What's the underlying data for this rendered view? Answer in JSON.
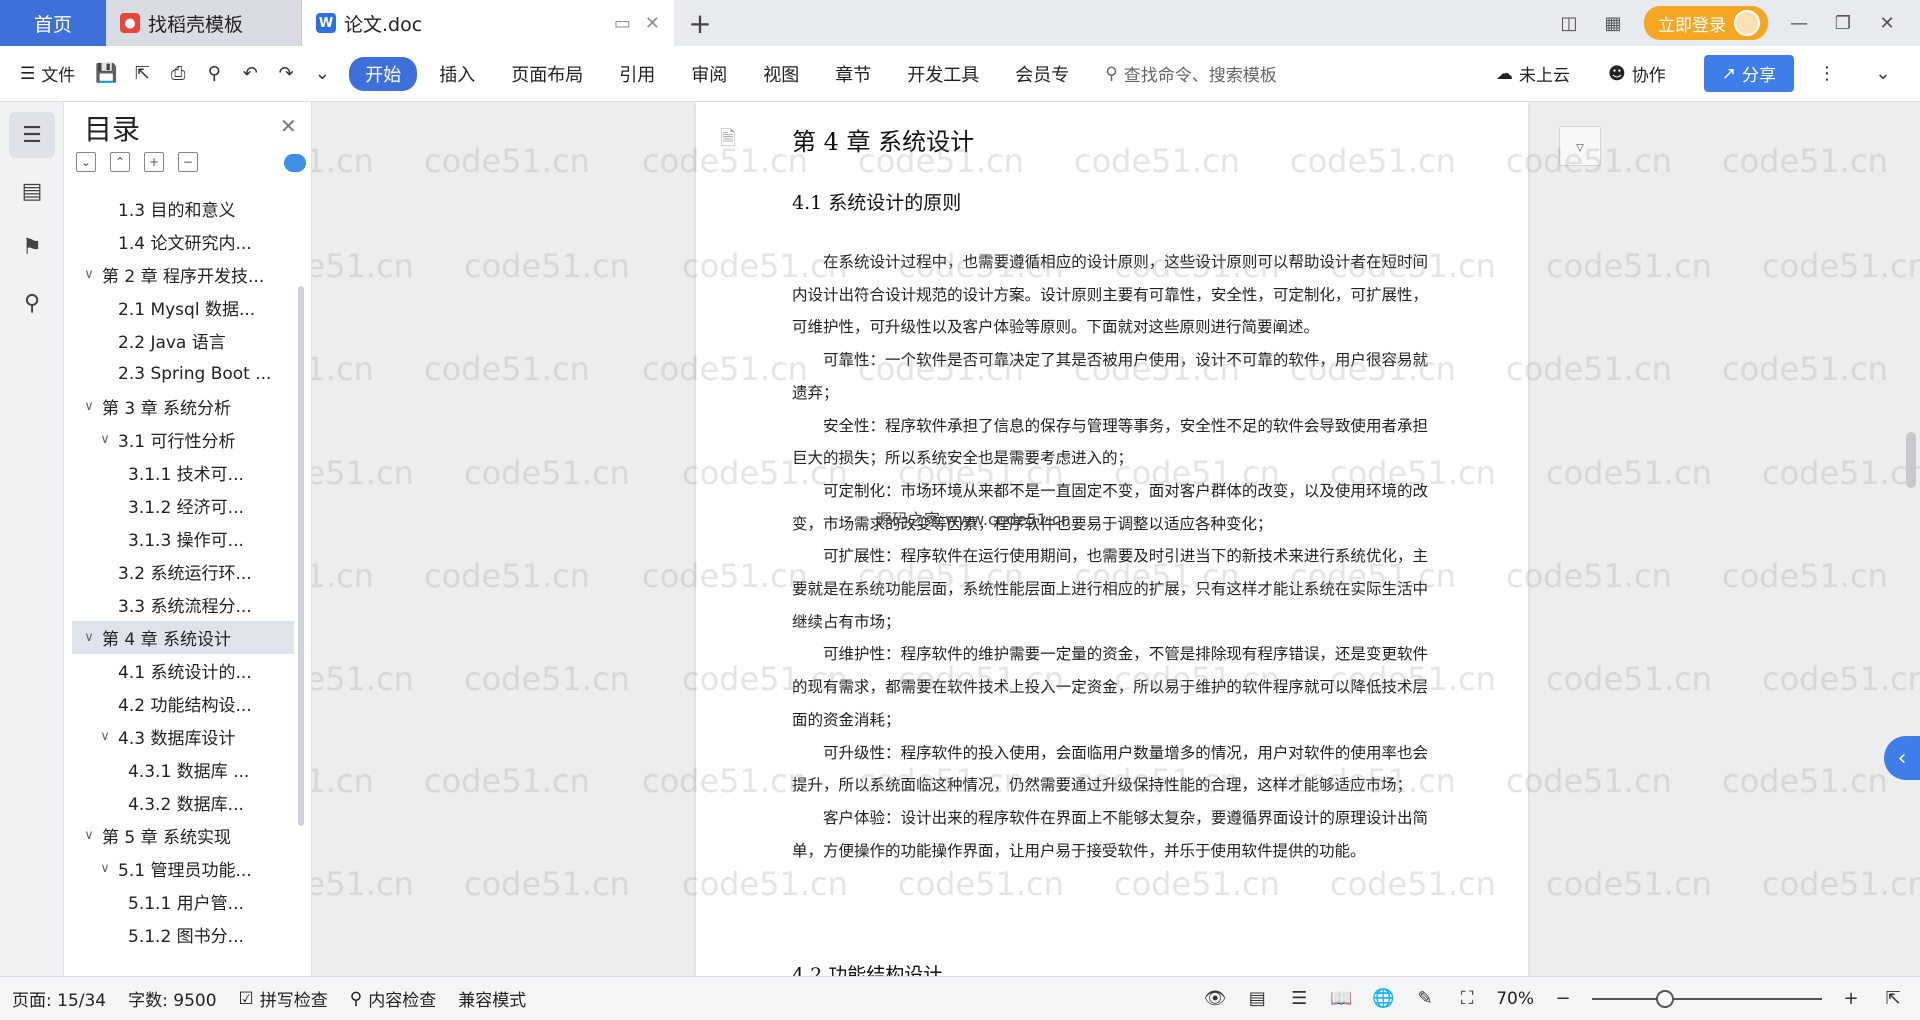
{
  "tabs": {
    "home": "首页",
    "daoke": "找稻壳模板",
    "doc": "论文.doc"
  },
  "header": {
    "login": "立即登录"
  },
  "toolbar": {
    "file": "文件",
    "ribbon": [
      "开始",
      "插入",
      "页面布局",
      "引用",
      "审阅",
      "视图",
      "章节",
      "开发工具",
      "会员专"
    ],
    "search_placeholder": "查找命令、搜索模板",
    "cloud": "未上云",
    "collab": "协作",
    "share": "分享"
  },
  "toc": {
    "title": "目录",
    "items": [
      {
        "label": "1.3  目的和意义",
        "level": 2
      },
      {
        "label": "1.4  论文研究内...",
        "level": 2
      },
      {
        "label": "第 2 章  程序开发技...",
        "level": 1
      },
      {
        "label": "2.1 Mysql 数据...",
        "level": 2
      },
      {
        "label": "2.2 Java 语言",
        "level": 2
      },
      {
        "label": "2.3 Spring Boot ...",
        "level": 2
      },
      {
        "label": "第 3 章  系统分析",
        "level": 1
      },
      {
        "label": "3.1 可行性分析",
        "level": 2
      },
      {
        "label": "3.1.1 技术可...",
        "level": 3
      },
      {
        "label": "3.1.2 经济可...",
        "level": 3
      },
      {
        "label": "3.1.3 操作可...",
        "level": 3
      },
      {
        "label": "3.2 系统运行环...",
        "level": 2
      },
      {
        "label": "3.3 系统流程分...",
        "level": 2
      },
      {
        "label": "第 4 章  系统设计",
        "level": 1
      },
      {
        "label": "4.1  系统设计的...",
        "level": 2
      },
      {
        "label": "4.2  功能结构设...",
        "level": 2
      },
      {
        "label": "4.3  数据库设计",
        "level": 2
      },
      {
        "label": "4.3.1  数据库 ...",
        "level": 3
      },
      {
        "label": "4.3.2  数据库...",
        "level": 3
      },
      {
        "label": "第 5 章  系统实现",
        "level": 1
      },
      {
        "label": "5.1 管理员功能...",
        "level": 2
      },
      {
        "label": "5.1.1  用户管...",
        "level": 3
      },
      {
        "label": "5.1.2  图书分...",
        "level": 3
      }
    ]
  },
  "document": {
    "chapter": "第 4 章  系统设计",
    "section": "4.1  系统设计的原则",
    "paragraphs": [
      "在系统设计过程中，也需要遵循相应的设计原则，这些设计原则可以帮助设计者在短时间内设计出符合设计规范的设计方案。设计原则主要有可靠性，安全性，可定制化，可扩展性，可维护性，可升级性以及客户体验等原则。下面就对这些原则进行简要阐述。",
      "可靠性：一个软件是否可靠决定了其是否被用户使用，设计不可靠的软件，用户很容易就遗弃；",
      "安全性：程序软件承担了信息的保存与管理等事务，安全性不足的软件会导致使用者承担巨大的损失；所以系统安全也是需要考虑进入的；",
      "可定制化：市场环境从来都不是一直固定不变，面对客户群体的改变，以及使用环境的改变，市场需求的改变等因素，程序软件也要易于调整以适应各种变化；",
      "可扩展性：程序软件在运行使用期间，也需要及时引进当下的新技术来进行系统优化，主要就是在系统功能层面，系统性能层面上进行相应的扩展，只有这样才能让系统在实际生活中继续占有市场；",
      "可维护性：程序软件的维护需要一定量的资金，不管是排除现有程序错误，还是变更软件的现有需求，都需要在软件技术上投入一定资金，所以易于维护的软件程序就可以降低技术层面的资金消耗；",
      "可升级性：程序软件的投入使用，会面临用户数量增多的情况，用户对软件的使用率也会提升，所以系统面临这种情况，仍然需要通过升级保持性能的合理，这样才能够适应市场；",
      "客户体验：设计出来的程序软件在界面上不能够太复杂，要遵循界面设计的原理设计出简单，方便操作的功能操作界面，让用户易于接受软件，并乐于使用软件提供的功能。"
    ],
    "next_section": "4.2  功能结构设计",
    "annotation": "源码之家 www.code51.cn"
  },
  "watermark": "code51.cn",
  "status": {
    "page": "页面: 15/34",
    "words": "字数: 9500",
    "spell": "拼写检查",
    "content": "内容检查",
    "compat": "兼容模式",
    "zoom": "70%"
  }
}
